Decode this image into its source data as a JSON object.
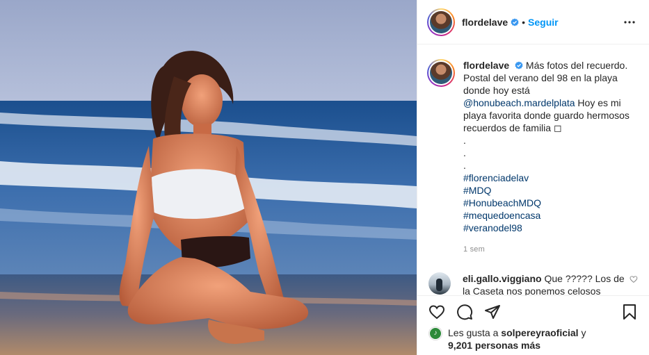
{
  "post": {
    "author": "flordelave",
    "separator": "•",
    "follow_label": "Seguir"
  },
  "caption": {
    "username": "flordelave",
    "text_1": "Más fotos del recuerdo. Postal del verano del 98 en la playa donde hoy está ",
    "mention": "@honubeach.mardelplata",
    "text_2": " Hoy es mi playa favorita donde guardo hermosos recuerdos de familia ◻",
    "dots": [
      ".",
      ".",
      "."
    ],
    "hashtags": [
      "#florenciadelav",
      "#MDQ",
      "#HonubeachMDQ",
      "#mequedoencasa",
      "#veranodel98"
    ],
    "time": "1 sem"
  },
  "comment": {
    "username": "eli.gallo.viggiano",
    "text": " Que ????? Los de la Caseta nos ponemos celosos"
  },
  "likes": {
    "prefix": "Les gusta a ",
    "user": "solpereyraoficial",
    "middle": " y",
    "count": "9,201 personas más"
  },
  "icons": {
    "verified": "verified-badge-icon",
    "more": "more-options-icon",
    "like": "heart-icon",
    "comment": "comment-icon",
    "share": "share-icon",
    "save": "bookmark-icon"
  },
  "colors": {
    "link_blue": "#0095f6",
    "tag_blue": "#00376b",
    "muted": "#8e8e8e",
    "text": "#262626"
  }
}
